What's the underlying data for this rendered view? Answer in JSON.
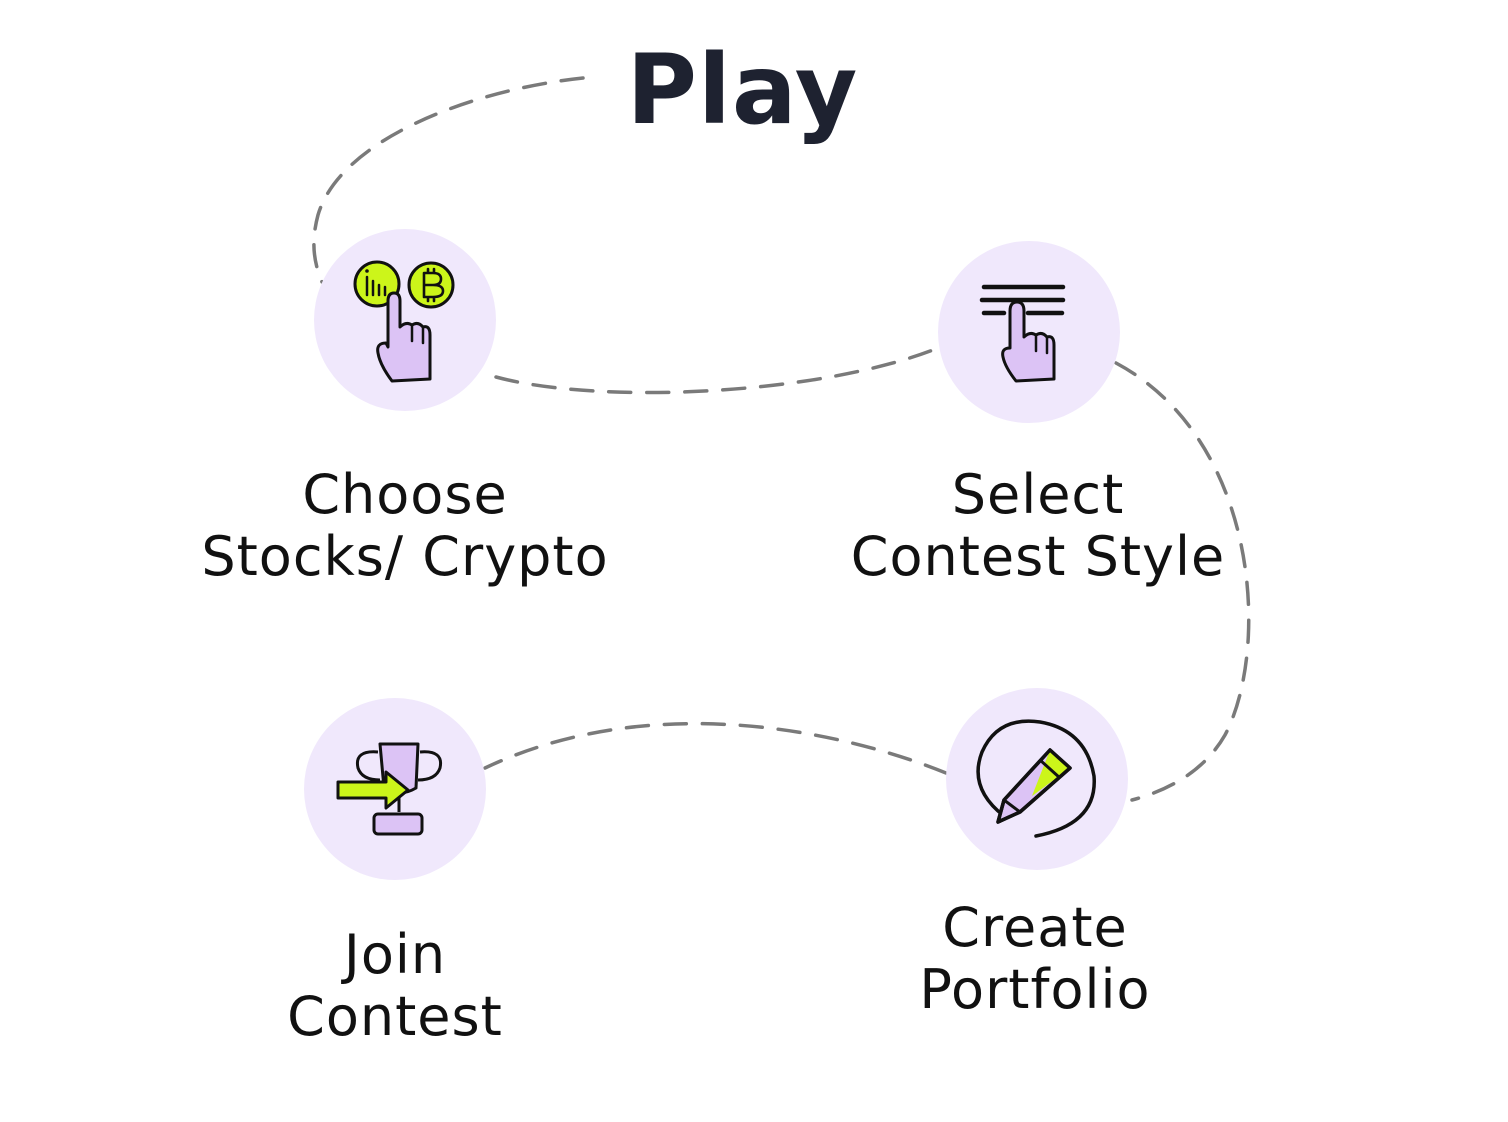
{
  "title": "Play",
  "colors": {
    "circle_fill": "#f0e8fc",
    "accent_green": "#ccf51a",
    "accent_purple": "#dcc3f5",
    "title_color": "#1e2230",
    "path_color": "#7a7a7a"
  },
  "steps": [
    {
      "icon": "coins-tap-icon",
      "label_lines": [
        "Choose",
        "Stocks/ Crypto"
      ]
    },
    {
      "icon": "menu-select-icon",
      "label_lines": [
        "Select",
        "Contest Style"
      ]
    },
    {
      "icon": "pencil-portfolio-icon",
      "label_lines": [
        "Create",
        "Portfolio"
      ]
    },
    {
      "icon": "trophy-join-icon",
      "label_lines": [
        "Join",
        "Contest"
      ]
    }
  ]
}
